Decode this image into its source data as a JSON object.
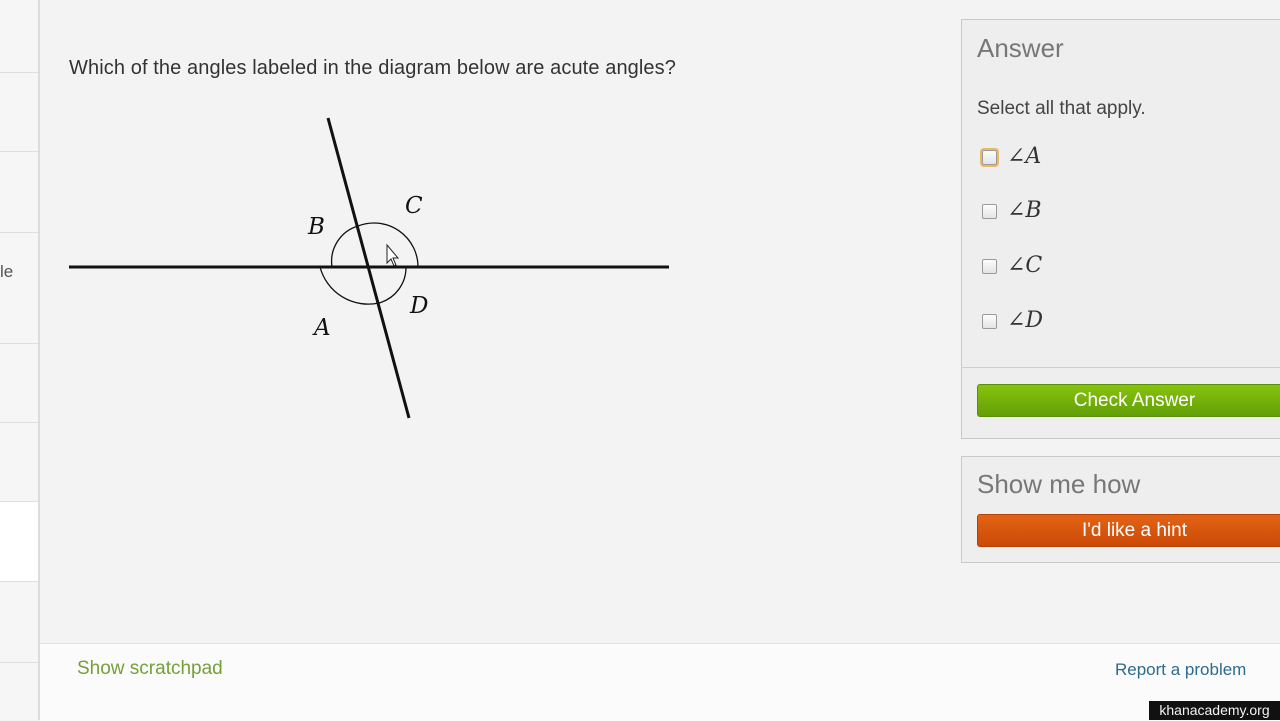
{
  "sidebar": {
    "partial_label": "le"
  },
  "question": {
    "text": "Which of the angles labeled in the diagram below are acute angles?"
  },
  "diagram": {
    "labels": {
      "A": "A",
      "B": "B",
      "C": "C",
      "D": "D"
    }
  },
  "answer": {
    "title": "Answer",
    "instruction": "Select all that apply.",
    "choices": [
      {
        "label": "∠A",
        "checked": false
      },
      {
        "label": "∠B",
        "checked": false
      },
      {
        "label": "∠C",
        "checked": false
      },
      {
        "label": "∠D",
        "checked": false
      }
    ],
    "check_button": "Check Answer"
  },
  "hint": {
    "title": "Show me how",
    "button": "I'd like a hint"
  },
  "footer": {
    "scratchpad": "Show scratchpad",
    "report": "Report a problem"
  },
  "watermark": "khanacademy.org",
  "colors": {
    "check_button": "#6cac0a",
    "hint_button": "#d65410",
    "scratchpad_link": "#74a03a",
    "report_link": "#2b6c8c",
    "focus_ring": "#e8b966"
  },
  "icons": [
    "mouse-cursor-icon"
  ]
}
